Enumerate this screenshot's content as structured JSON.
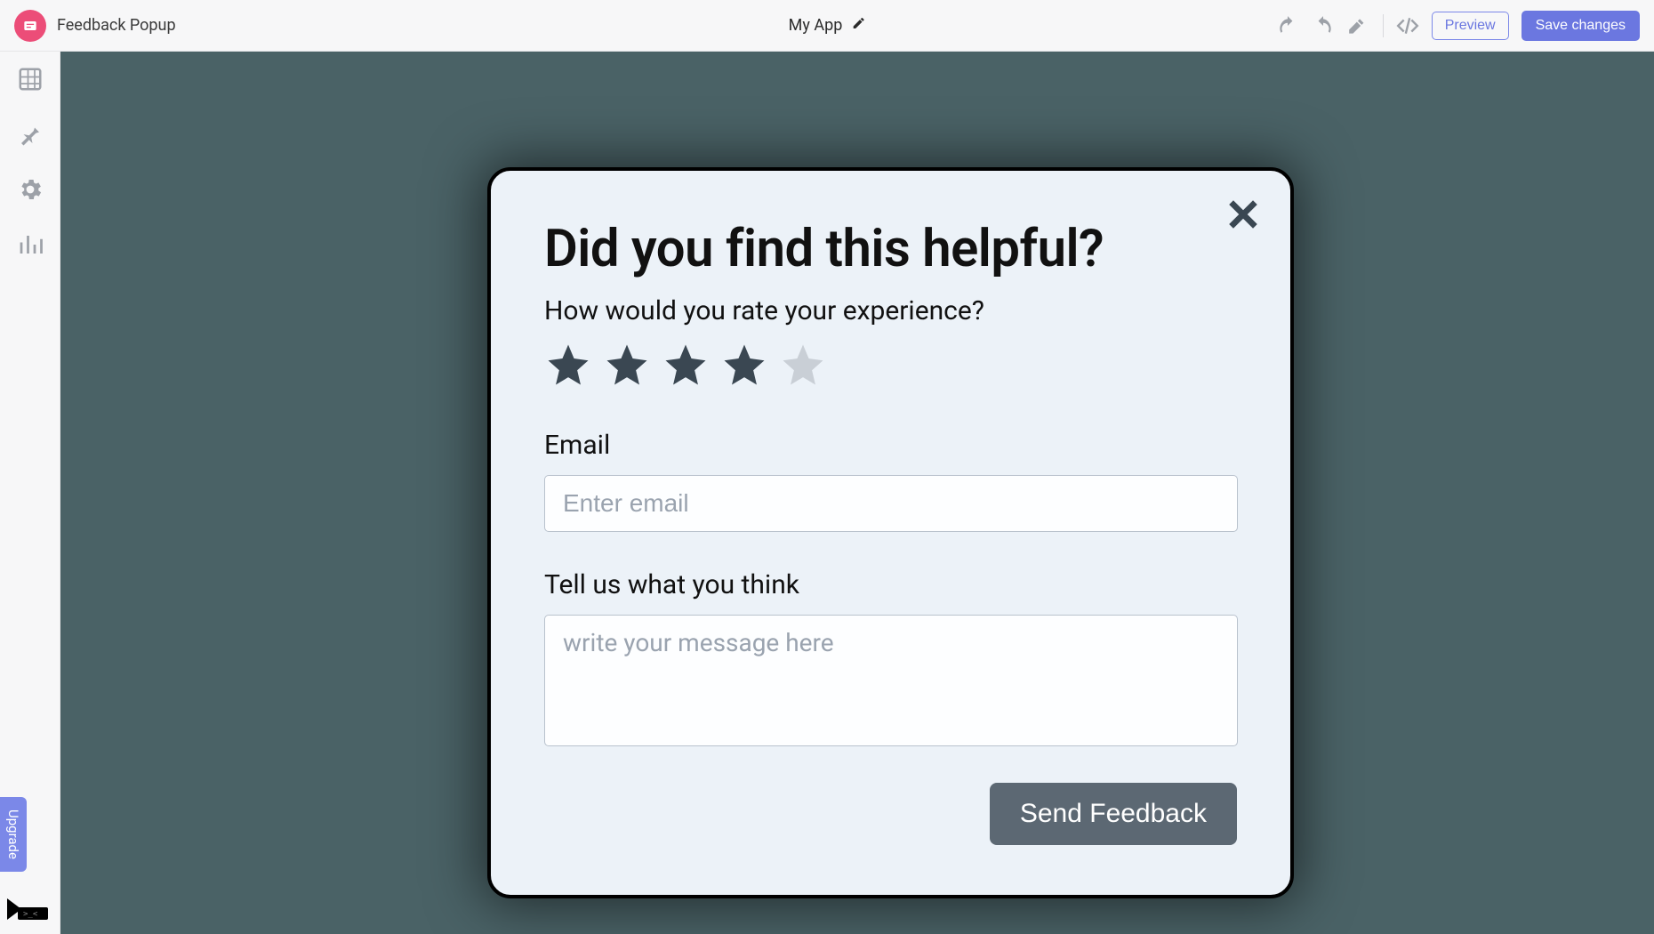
{
  "topbar": {
    "title": "Feedback Popup",
    "app_name": "My App",
    "preview_label": "Preview",
    "save_label": "Save changes"
  },
  "sidebar": {
    "upgrade_label": "Upgrade"
  },
  "popup": {
    "heading": "Did you find this helpful?",
    "subheading": "How would you rate your experience?",
    "rating": {
      "value": 4,
      "max": 5
    },
    "email_label": "Email",
    "email_placeholder": "Enter email",
    "message_label": "Tell us what you think",
    "message_placeholder": "write your message here",
    "submit_label": "Send Feedback"
  },
  "colors": {
    "accent": "#6b77e0",
    "logo": "#ec4d78",
    "canvas": "#4a6266",
    "popup_bg": "#ecf2f8",
    "star_filled": "#3a4752",
    "star_empty": "#c9cfd6",
    "send_btn": "#5c6873"
  }
}
